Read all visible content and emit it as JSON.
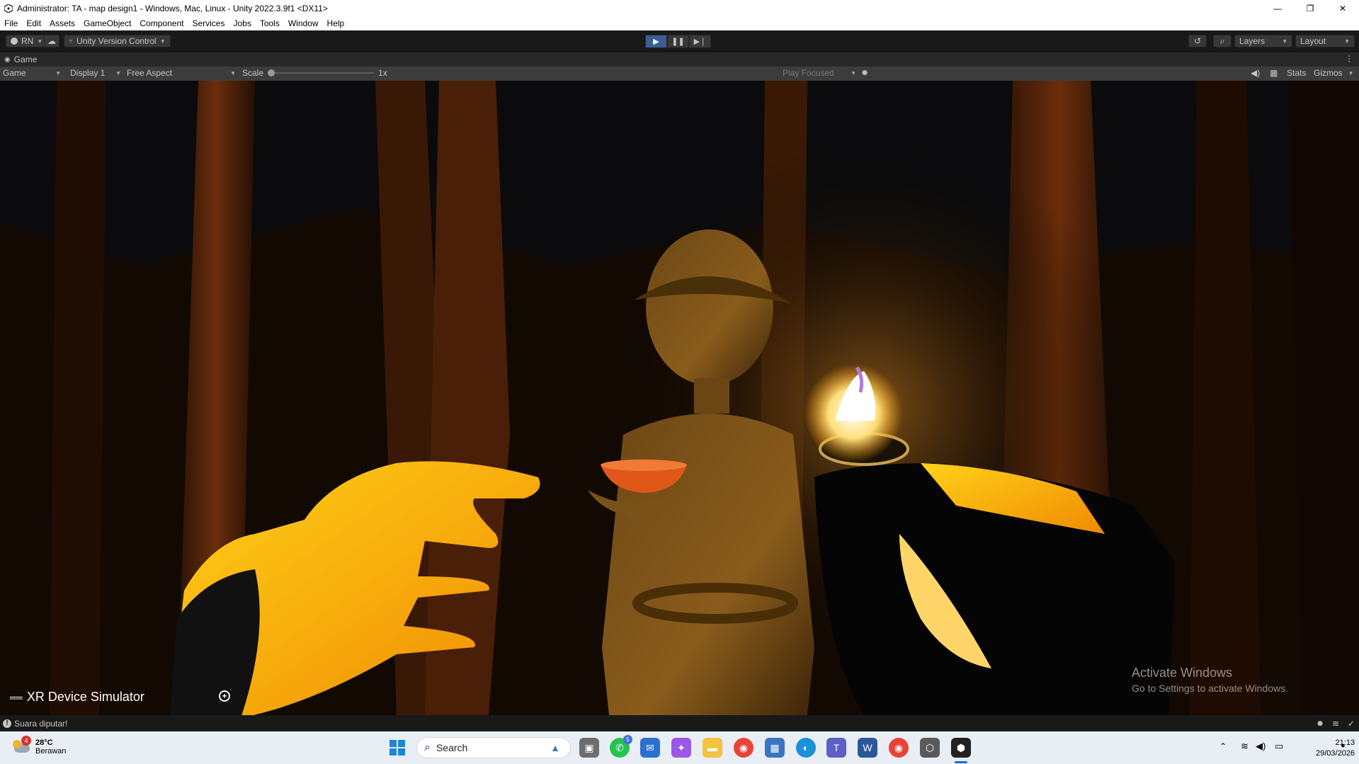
{
  "window": {
    "title": "Administrator: TA - map design1 - Windows, Mac, Linux - Unity 2022.3.9f1 <DX11>",
    "minimize": "—",
    "maximize": "❐",
    "close": "✕"
  },
  "menu": [
    "File",
    "Edit",
    "Assets",
    "GameObject",
    "Component",
    "Services",
    "Jobs",
    "Tools",
    "Window",
    "Help"
  ],
  "toolbar": {
    "account": "RN",
    "version_control": "Unity Version Control",
    "layers": "Layers",
    "layout": "Layout"
  },
  "tab": {
    "label": "Game"
  },
  "gamebar": {
    "mode": "Game",
    "display": "Display 1",
    "aspect": "Free Aspect",
    "scale_label": "Scale",
    "scale_value": "1x",
    "play_focused": "Play Focused",
    "stats": "Stats",
    "gizmos": "Gizmos"
  },
  "overlay": {
    "xr_simulator": "XR Device Simulator",
    "activate_title": "Activate Windows",
    "activate_sub": "Go to Settings to activate Windows."
  },
  "status": {
    "message": "Suara diputar!"
  },
  "taskbar": {
    "weather_temp": "28°C",
    "weather_desc": "Berawan",
    "weather_badge": "4",
    "search": "Search",
    "whatsapp_badge": "5",
    "time": "21:13",
    "date": "29/03/2026"
  },
  "colors": {
    "accent_play": "#3b5f8f",
    "editor_bg": "#191919",
    "hand_yellow": "#ffb700"
  }
}
